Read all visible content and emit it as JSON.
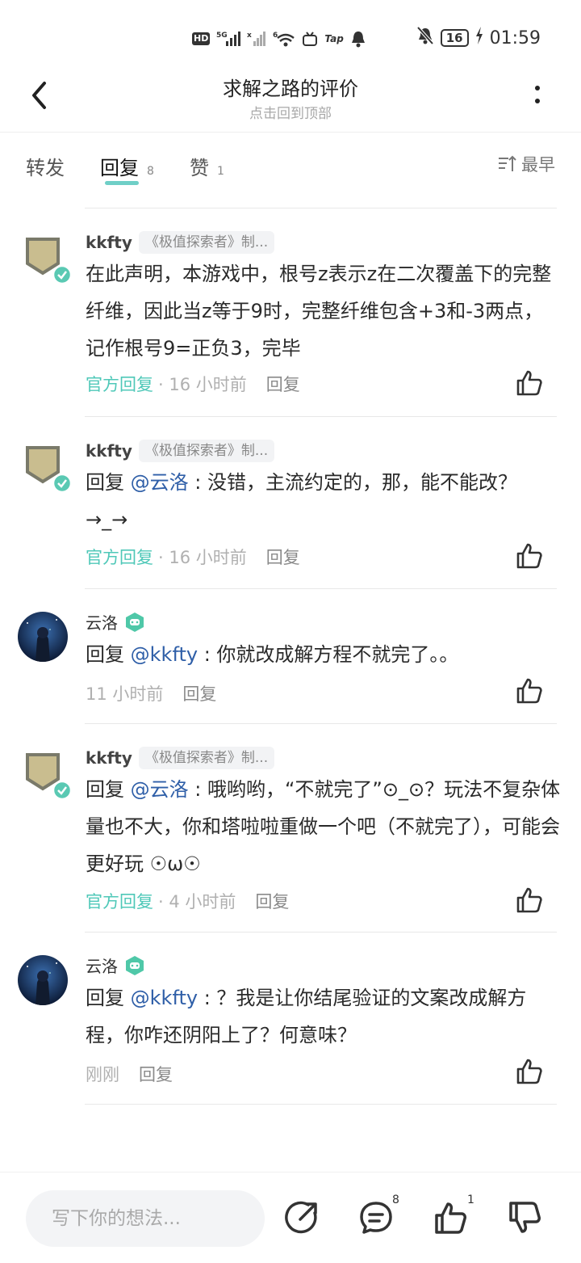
{
  "status_bar": {
    "left_icons": [
      "HD",
      "5G",
      "6",
      "Tap"
    ],
    "battery": "16",
    "time": "01:59"
  },
  "header": {
    "title": "求解之路的评价",
    "subtitle": "点击回到顶部"
  },
  "tabs": [
    {
      "label": "转发",
      "count": ""
    },
    {
      "label": "回复",
      "count": "8"
    },
    {
      "label": "赞",
      "count": "1"
    }
  ],
  "sort_label": "最早",
  "comments": [
    {
      "author": "kkfty",
      "tag": "《极值探索者》制...",
      "text_prefix": "",
      "mention": "",
      "text": "在此声明，本游戏中，根号z表示z在二次覆盖下的完整纤维，因此当z等于9时，完整纤维包含+3和-3两点，记作根号9=正负3，完毕",
      "official": "官方回复",
      "time": "· 16 小时前",
      "reply": "回复"
    },
    {
      "author": "kkfty",
      "tag": "《极值探索者》制...",
      "text_prefix": "回复 ",
      "mention": "@云洛",
      "text": " : 没错，主流约定的，那，能不能改？ →_→",
      "official": "官方回复",
      "time": "· 16 小时前",
      "reply": "回复"
    },
    {
      "author": "云洛",
      "tag": "",
      "text_prefix": "回复 ",
      "mention": "@kkfty",
      "text": " : 你就改成解方程不就完了。。",
      "official": "",
      "time": "11 小时前",
      "reply": "回复"
    },
    {
      "author": "kkfty",
      "tag": "《极值探索者》制...",
      "text_prefix": "回复 ",
      "mention": "@云洛",
      "text": " : 哦哟哟，“不就完了”⊙_⊙？玩法不复杂体量也不大，你和塔啦啦重做一个吧（不就完了），可能会更好玩 ☉ω☉",
      "official": "官方回复",
      "time": "· 4 小时前",
      "reply": "回复"
    },
    {
      "author": "云洛",
      "tag": "",
      "text_prefix": "回复 ",
      "mention": "@kkfty",
      "text": " : ？我是让你结尾验证的文案改成解方程，你咋还阴阳上了？何意味？",
      "official": "",
      "time": "刚刚",
      "reply": "回复"
    }
  ],
  "bottom_bar": {
    "input_placeholder": "写下你的想法...",
    "comment_count": "8",
    "like_count": "1"
  },
  "colors": {
    "accent": "#4fc8b8",
    "mention": "#2f5fa8",
    "badge_fill": "#c9bd8f",
    "badge_border": "#7a7a6a"
  }
}
